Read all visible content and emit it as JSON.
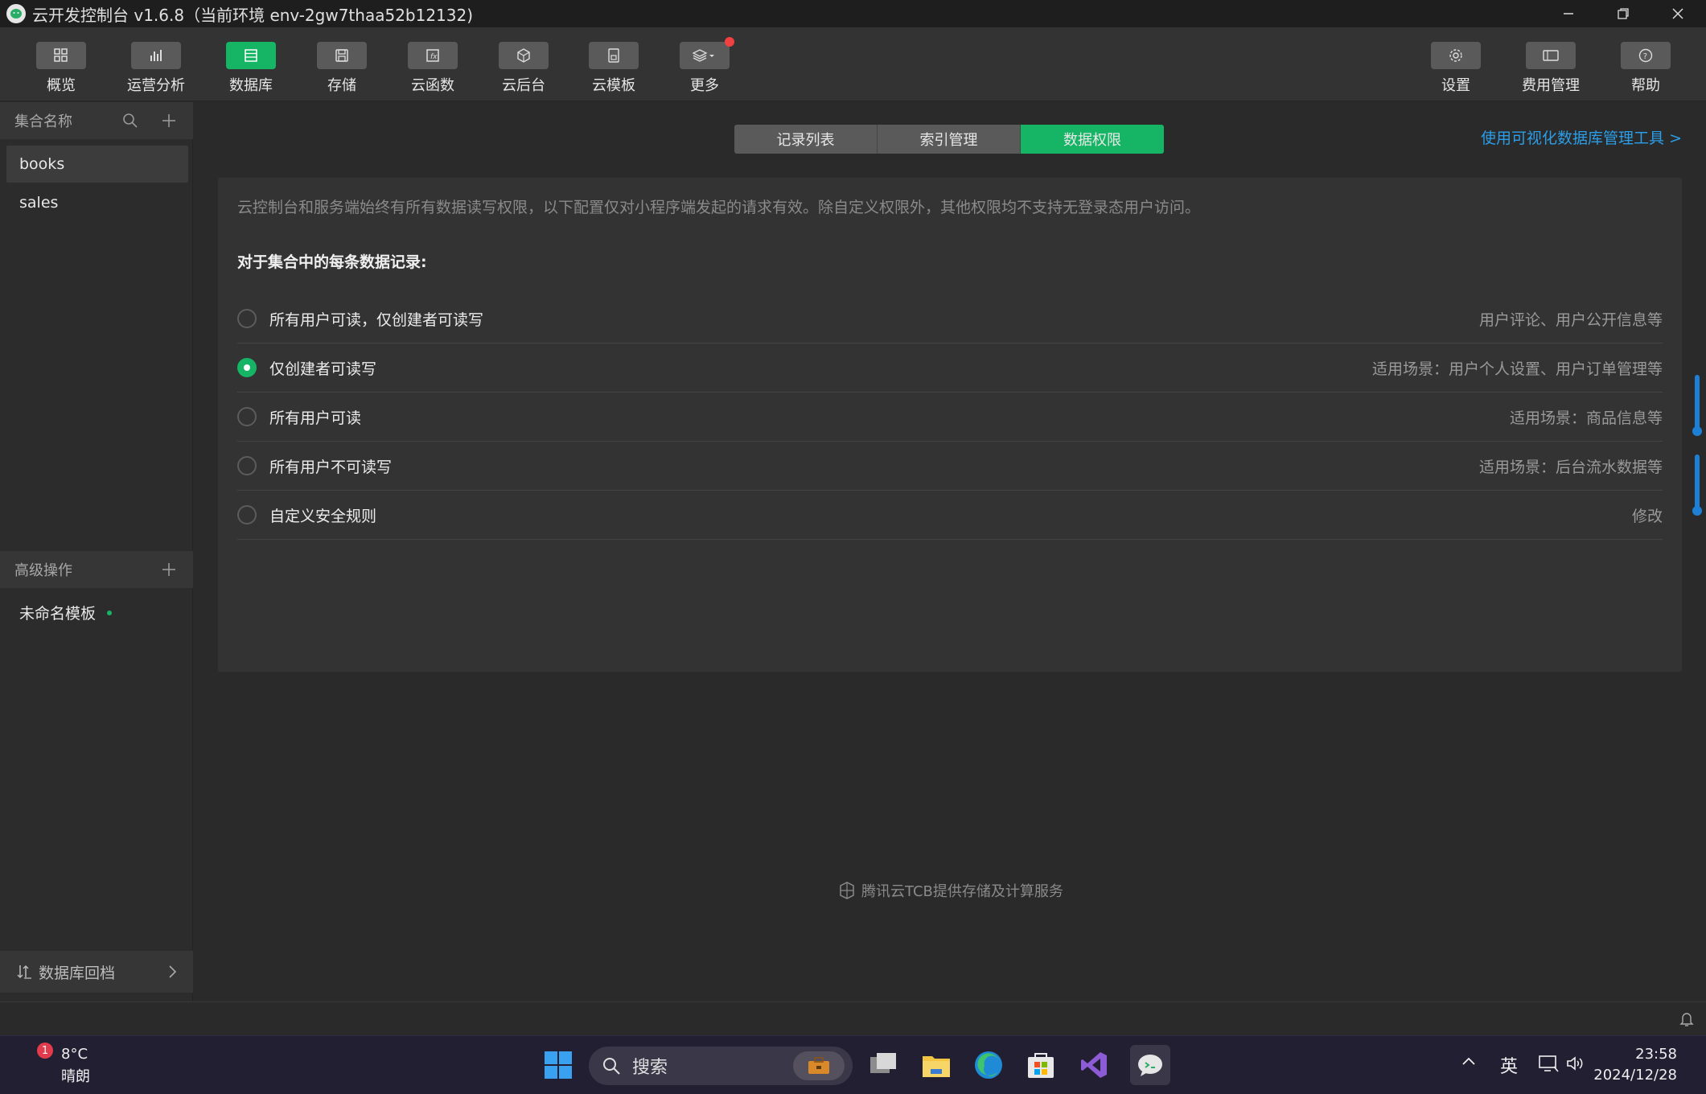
{
  "window": {
    "title": "云开发控制台 v1.6.8（当前环境 env-2gw7thaa52b12132)"
  },
  "toolbar": {
    "items": [
      {
        "label": "概览",
        "icon": "grid-icon"
      },
      {
        "label": "运营分析",
        "icon": "bar-chart-icon"
      },
      {
        "label": "数据库",
        "icon": "database-icon",
        "active": true
      },
      {
        "label": "存储",
        "icon": "storage-icon"
      },
      {
        "label": "云函数",
        "icon": "function-icon"
      },
      {
        "label": "云后台",
        "icon": "cube-icon"
      },
      {
        "label": "云模板",
        "icon": "template-icon"
      },
      {
        "label": "更多",
        "icon": "layers-icon"
      }
    ],
    "right_items": [
      {
        "label": "设置",
        "icon": "gear-icon"
      },
      {
        "label": "费用管理",
        "icon": "billing-icon"
      },
      {
        "label": "帮助",
        "icon": "help-icon"
      }
    ]
  },
  "sidebar": {
    "collections_header": "集合名称",
    "collections": [
      "books",
      "sales"
    ],
    "advanced_header": "高级操作",
    "template_item": "未命名模板",
    "backup_label": "数据库回档"
  },
  "main": {
    "tabs": [
      "记录列表",
      "索引管理",
      "数据权限"
    ],
    "active_tab": "数据权限",
    "visual_tool_link": "使用可视化数据库管理工具 >",
    "notice": "云控制台和服务端始终有所有数据读写权限，以下配置仅对小程序端发起的请求有效。除自定义权限外，其他权限均不支持无登录态用户访问。",
    "for_each_label": "对于集合中的每条数据记录:",
    "options": [
      {
        "label": "所有用户可读，仅创建者可读写",
        "hint": "用户评论、用户公开信息等",
        "selected": false
      },
      {
        "label": "仅创建者可读写",
        "hint": "适用场景：用户个人设置、用户订单管理等",
        "selected": true
      },
      {
        "label": "所有用户可读",
        "hint": "适用场景：商品信息等",
        "selected": false
      },
      {
        "label": "所有用户不可读写",
        "hint": "适用场景：后台流水数据等",
        "selected": false
      },
      {
        "label": "自定义安全规则",
        "hint": "修改",
        "selected": false
      }
    ],
    "credit": "腾讯云TCB提供存储及计算服务"
  },
  "taskbar": {
    "weather_badge": "1",
    "temperature": "8°C",
    "condition": "晴朗",
    "search_placeholder": "搜索",
    "ime": "英",
    "time": "23:58",
    "date": "2024/12/28"
  },
  "colors": {
    "accent_green": "#16b566",
    "link_blue": "#2a9ee8",
    "notification_red": "#f04040"
  }
}
